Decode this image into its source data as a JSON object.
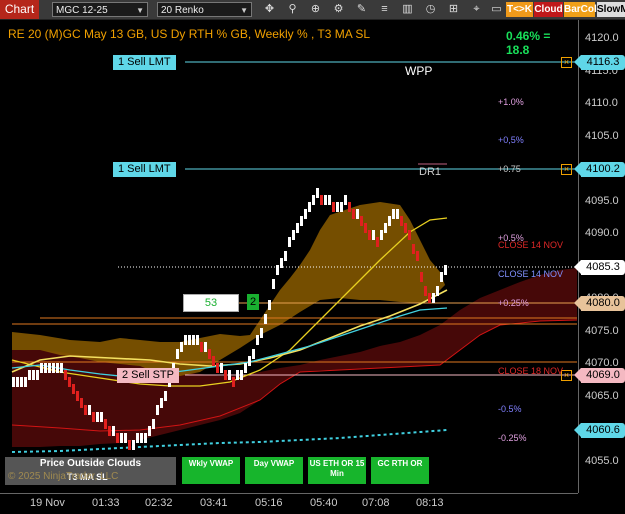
{
  "toolbar": {
    "chart_tab": "Chart",
    "instrument": "MGC 12-25",
    "period": "20 Renko",
    "tags": [
      "T<>K",
      "Cloud",
      "BarCol",
      "SlowM"
    ],
    "icons": [
      "dropdown-icon",
      "dropdown-icon",
      "crosshair-icon",
      "zoom-icon",
      "pointer-icon",
      "properties-icon",
      "draw-icon",
      "lines-icon",
      "bars-icon",
      "clock-icon",
      "pin-icon"
    ]
  },
  "header": {
    "title": "RE 20  (M)GC May 13 GB, US Dy RTH % GB, Weekly % , T3 MA SL",
    "change": "0.46% = 18.8"
  },
  "price_axis": {
    "ticks": [
      "4120.0",
      "4115.0",
      "4110.0",
      "4105.0",
      "4100.0",
      "4095.0",
      "4090.0",
      "4085.0",
      "4080.0",
      "4075.0",
      "4070.0",
      "4065.0",
      "4060.0",
      "4055.0"
    ],
    "markers": [
      {
        "name": "sell-limit-1-price",
        "text": "4116.3",
        "color": "#5fd7e8"
      },
      {
        "name": "sell-limit-2-price",
        "text": "4100.2",
        "color": "#5fd7e8"
      },
      {
        "name": "last-price",
        "text": "4085.3",
        "color": "#ffffff"
      },
      {
        "name": "level-4080-price",
        "text": "4080.0",
        "color": "#e8c39a"
      },
      {
        "name": "stop-price",
        "text": "4069.0",
        "color": "#f4b9c2"
      },
      {
        "name": "low-price",
        "text": "4060.6",
        "color": "#5fd7e8"
      }
    ]
  },
  "time_axis": [
    "19 Nov",
    "01:33",
    "02:32",
    "03:41",
    "05:16",
    "05:40",
    "07:08",
    "08:13"
  ],
  "orders": {
    "sell_lmt_1": "1 Sell LMT",
    "sell_lmt_2": "1 Sell LMT",
    "sell_stp": "2 Sell STP",
    "qty_box": "53",
    "qty_badge": "2"
  },
  "overlays": {
    "wpp": "WPP",
    "dr1": "DR1",
    "pct_plus_1": "+1.0%",
    "pct_plus_05a": "+0,5%",
    "pct_plus_075": "+0.75",
    "pct_plus_05b": "+0.5%",
    "close_14_red": "CLOSE 14 NOV",
    "close_14_blue": "CLOSE 14 NOV",
    "pct_plus_025": "+0.25%",
    "close_18": "CLOSE 18 NOV",
    "pct_minus_05": "-0.5%",
    "pct_minus_025": "-0.25%"
  },
  "buttons": {
    "price_outside": "Price Outside Clouds",
    "t3": "T3 MA SL",
    "copyright": "© 2025 NinjaTrader, LLC",
    "wkly_vwap": "Wkly VWAP",
    "day_vwap": "Day VWAP",
    "us_eth": "US ETH OR 15 Min",
    "gc_rth": "GC RTH OR"
  },
  "colors": {
    "up_brick": "#ffffff",
    "down_brick": "#e0201e",
    "cloud_gold": "#8a5c00",
    "cloud_red": "#5a0a0a",
    "accent_cyan": "#5fd7e8",
    "green_button": "#17b52c"
  }
}
